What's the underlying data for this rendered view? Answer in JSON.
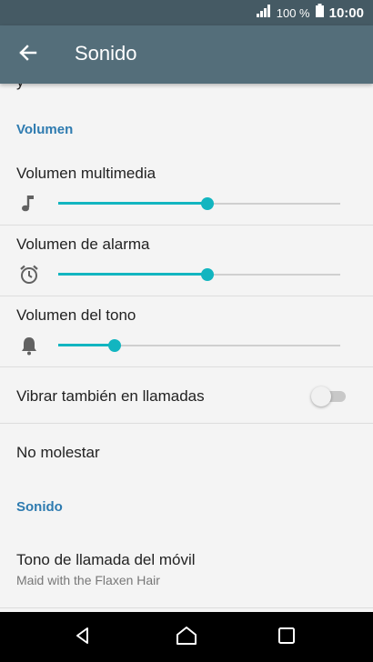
{
  "status_bar": {
    "battery_percent": "100 %",
    "time": "10:00"
  },
  "app_bar": {
    "title": "Sonido"
  },
  "content": {
    "cut_off_text": "y",
    "volume_section_header": "Volumen",
    "sliders": [
      {
        "title": "Volumen multimedia",
        "icon": "music-note-icon",
        "level": 0.53
      },
      {
        "title": "Volumen de alarma",
        "icon": "alarm-clock-icon",
        "level": 0.53
      },
      {
        "title": "Volumen del tono",
        "icon": "bell-icon",
        "level": 0.2
      }
    ],
    "vibrate": {
      "label": "Vibrar también en llamadas",
      "on": false
    },
    "do_not_disturb": {
      "label": "No molestar"
    },
    "sound_section_header": "Sonido",
    "ringtone": {
      "label": "Tono de llamada del móvil",
      "value": "Maid with the Flaxen Hair"
    }
  },
  "colors": {
    "status_bar": "#455a64",
    "app_bar": "#546e7a",
    "accent": "#12b5c0",
    "section_header": "#2e7bb0"
  }
}
